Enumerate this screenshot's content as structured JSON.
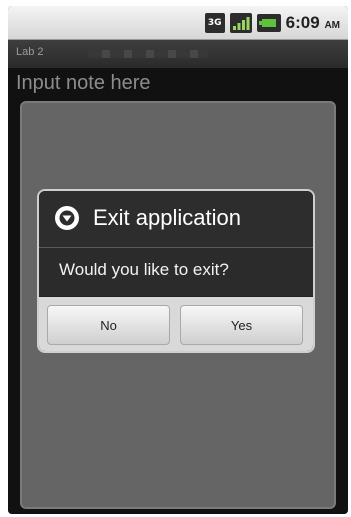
{
  "status_bar": {
    "network_icon": "3g-icon",
    "network_label": "3G",
    "signal_icon": "signal-icon",
    "battery_icon": "battery-icon",
    "time": "6:09",
    "ampm": "AM"
  },
  "app": {
    "title": "Lab 2"
  },
  "note": {
    "placeholder": "Input note here"
  },
  "dialog": {
    "icon": "info-down-icon",
    "title": "Exit application",
    "message": "Would you like to exit?",
    "buttons": {
      "no_label": "No",
      "yes_label": "Yes"
    }
  },
  "colors": {
    "background": "#1a1a1a",
    "dialog": "#2d2d2d",
    "button_bar": "#d9d9d9"
  }
}
